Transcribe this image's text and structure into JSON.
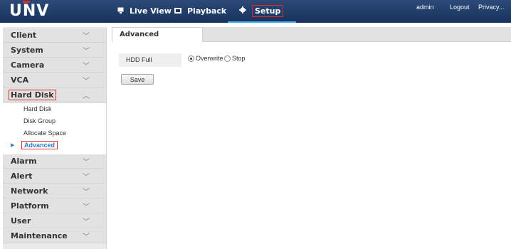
{
  "header": {
    "logo_text": "UNV",
    "nav": [
      {
        "label": "Live View",
        "icon": "monitor-icon"
      },
      {
        "label": "Playback",
        "icon": "film-icon"
      },
      {
        "label": "Setup",
        "icon": "gear-icon"
      }
    ],
    "links": [
      "admin",
      "Logout",
      "Privacy..."
    ],
    "accent_color": "#3fa9f5",
    "highlight_color": "#e0282e"
  },
  "sidebar": {
    "sections": [
      {
        "label": "Client",
        "chevron": "double-chevron-down-icon"
      },
      {
        "label": "System",
        "chevron": "double-chevron-down-icon"
      },
      {
        "label": "Camera",
        "chevron": "double-chevron-down-icon"
      },
      {
        "label": "VCA",
        "chevron": "double-chevron-down-icon"
      },
      {
        "label": "Hard Disk",
        "chevron": "double-chevron-up-icon",
        "expanded": true
      },
      {
        "label": "Alarm",
        "chevron": "double-chevron-down-icon"
      },
      {
        "label": "Alert",
        "chevron": "double-chevron-down-icon"
      },
      {
        "label": "Network",
        "chevron": "double-chevron-down-icon"
      },
      {
        "label": "Platform",
        "chevron": "double-chevron-down-icon"
      },
      {
        "label": "User",
        "chevron": "double-chevron-down-icon"
      },
      {
        "label": "Maintenance",
        "chevron": "double-chevron-down-icon"
      }
    ],
    "hard_disk_items": [
      "Hard Disk",
      "Disk Group",
      "Allocate Space",
      "Advanced"
    ],
    "active_item": "Advanced"
  },
  "main": {
    "tab": "Advanced",
    "hdd_full": {
      "label": "HDD Full",
      "options": [
        "Overwrite",
        "Stop"
      ],
      "selected": "Overwrite"
    },
    "save_label": "Save"
  }
}
